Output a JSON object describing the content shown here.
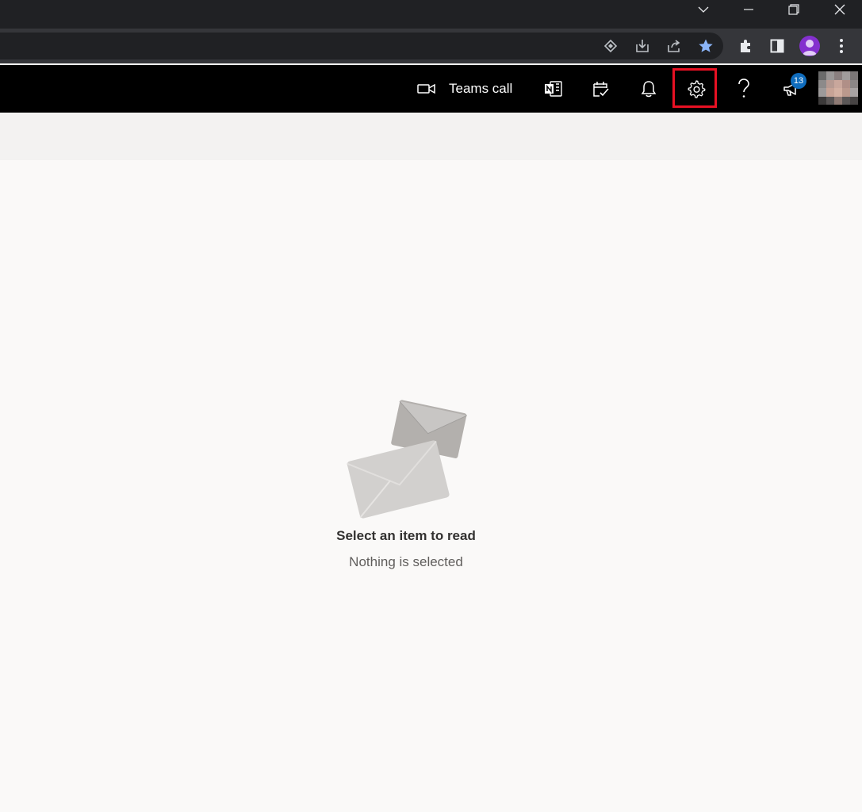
{
  "browser": {
    "window_controls": {
      "tab_search_icon": "chevron-down-icon",
      "minimize_icon": "minimize-icon",
      "restore_icon": "restore-icon",
      "close_icon": "close-icon"
    },
    "toolbar_icons": [
      "tracking-icon",
      "install-app-icon",
      "share-icon",
      "bookmark-star-icon",
      "extensions-icon",
      "side-panel-icon",
      "profile-icon",
      "kebab-menu-icon"
    ],
    "accent_star": "#8ab4f8"
  },
  "header": {
    "teams_call_label": "Teams call",
    "icons": [
      "video-camera-icon",
      "onenote-icon",
      "my-day-icon",
      "bell-icon",
      "gear-icon",
      "help-icon",
      "megaphone-icon"
    ],
    "whats_new_badge": "13",
    "highlight_color": "#e81123"
  },
  "reading_pane": {
    "empty_title": "Select an item to read",
    "empty_subtitle": "Nothing is selected"
  }
}
